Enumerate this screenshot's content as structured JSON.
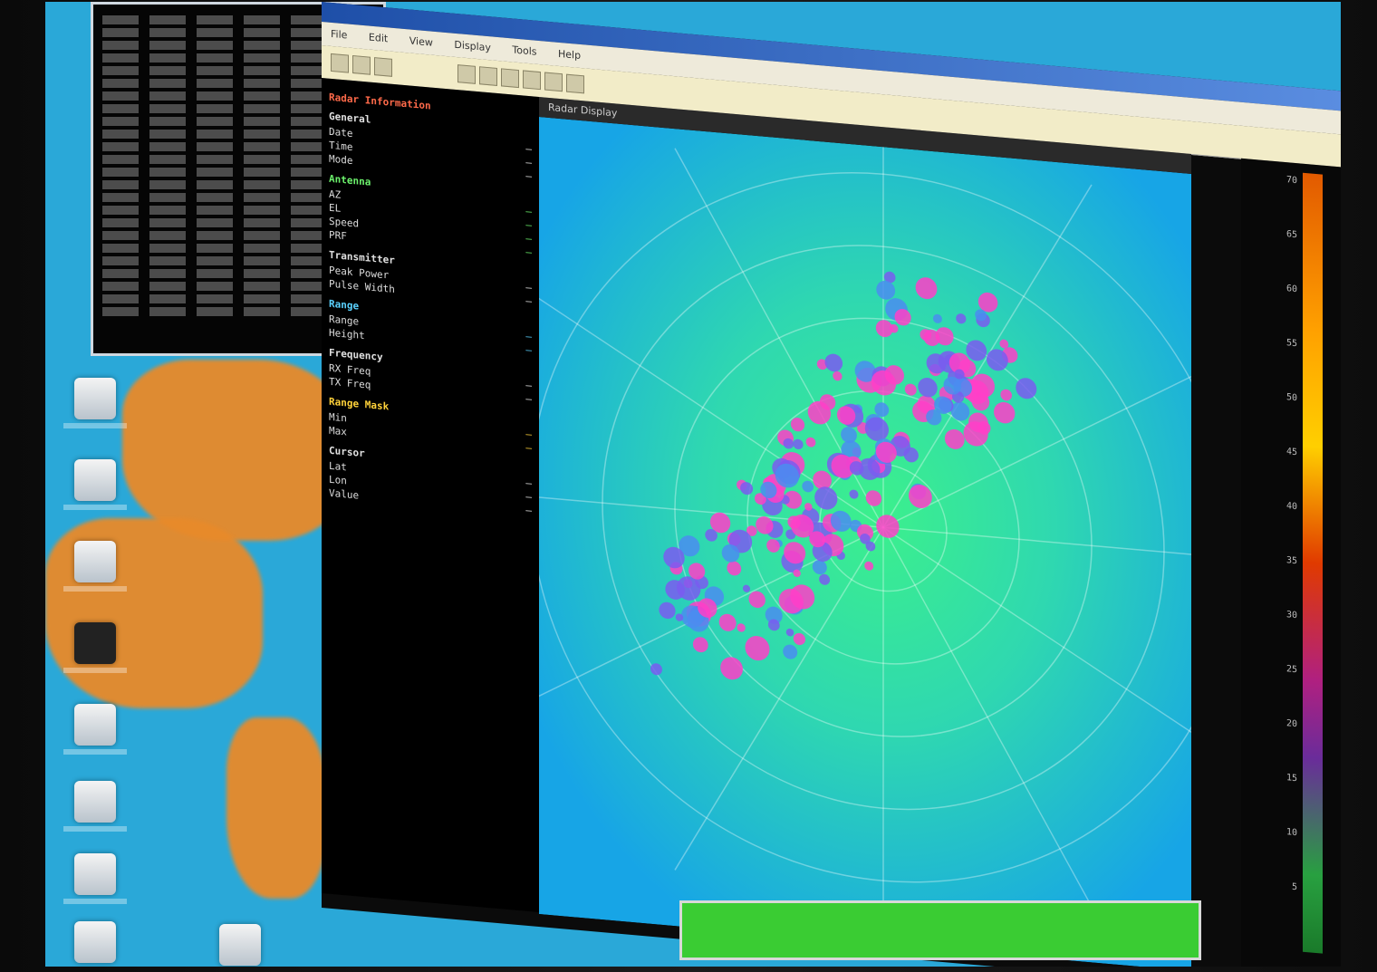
{
  "window": {
    "menu": [
      "File",
      "Edit",
      "View",
      "Display",
      "Tools",
      "Help"
    ],
    "status": "Radar Display"
  },
  "info_panel": {
    "header": "Radar Information",
    "sections": [
      {
        "title": "General",
        "color": "#e0e0e0",
        "rows": [
          {
            "label": "Date",
            "value": "—"
          },
          {
            "label": "Time",
            "value": "—"
          },
          {
            "label": "Mode",
            "value": "—"
          }
        ]
      },
      {
        "title": "Antenna",
        "color": "#6cf26c",
        "rows": [
          {
            "label": "AZ",
            "value": "—"
          },
          {
            "label": "EL",
            "value": "—"
          },
          {
            "label": "Speed",
            "value": "—"
          },
          {
            "label": "PRF",
            "value": "—"
          }
        ]
      },
      {
        "title": "Transmitter",
        "color": "#e0e0e0",
        "rows": [
          {
            "label": "Peak Power",
            "value": "—"
          },
          {
            "label": "Pulse Width",
            "value": "—"
          }
        ]
      },
      {
        "title": "Range",
        "color": "#5ad2ff",
        "rows": [
          {
            "label": "Range",
            "value": "—"
          },
          {
            "label": "Height",
            "value": "—"
          }
        ]
      },
      {
        "title": "Frequency",
        "color": "#e0e0e0",
        "rows": [
          {
            "label": "RX Freq",
            "value": "—"
          },
          {
            "label": "TX Freq",
            "value": "—"
          }
        ]
      },
      {
        "title": "Range Mask",
        "color": "#ffd23a",
        "rows": [
          {
            "label": "Min",
            "value": "—"
          },
          {
            "label": "Max",
            "value": "—"
          }
        ]
      },
      {
        "title": "Cursor",
        "color": "#e0e0e0",
        "rows": [
          {
            "label": "Lat",
            "value": "—"
          },
          {
            "label": "Lon",
            "value": "—"
          },
          {
            "label": "Value",
            "value": "—"
          }
        ]
      }
    ]
  },
  "scale": {
    "ticks": [
      "70",
      "65",
      "60",
      "55",
      "50",
      "45",
      "40",
      "35",
      "30",
      "25",
      "20",
      "15",
      "10",
      "5"
    ]
  },
  "taskbar": {
    "label": ""
  },
  "colors": {
    "background": "#2aa8d8",
    "radar_inner": "#3cf08c",
    "radar_outer": "#17a5e6",
    "echo": "#ff3ec8"
  }
}
